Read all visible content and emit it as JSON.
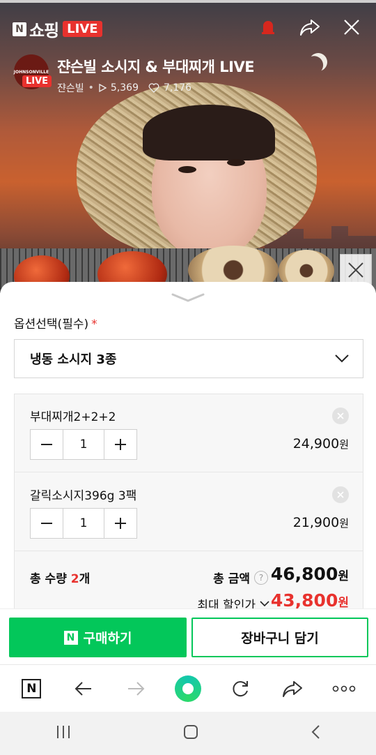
{
  "header": {
    "brand_mark": "N",
    "brand_name": "쇼핑",
    "live_tag": "LIVE"
  },
  "broadcast": {
    "title": "쟌슨빌 소시지 & 부대찌개 LIVE",
    "channel_name": "쟌슨빌",
    "separator": "•",
    "views": "5,369",
    "likes": "7,176",
    "avatar_brand": "JOHNSONVILLE",
    "avatar_live_badge": "LIVE"
  },
  "sheet": {
    "option_label": "옵션선택(필수)",
    "required_mark": "*",
    "selected_option": "냉동 소시지 3종",
    "items": [
      {
        "name": "부대찌개2+2+2",
        "quantity": "1",
        "price": "24,900",
        "currency": "원"
      },
      {
        "name": "갈릭소시지396g 3팩",
        "quantity": "1",
        "price": "21,900",
        "currency": "원"
      }
    ],
    "totals": {
      "quantity_label": "총 수량",
      "quantity_value": "2",
      "quantity_unit": "개",
      "amount_label": "총 금액",
      "help_glyph": "?",
      "amount_value": "46,800",
      "amount_unit": "원",
      "discount_label": "최대 할인가",
      "discount_value": "43,800",
      "discount_unit": "원"
    }
  },
  "actions": {
    "buy_logo": "N",
    "buy_label": "구매하기",
    "cart_label": "장바구니 담기"
  },
  "toolbar": {
    "home_logo": "N"
  },
  "colors": {
    "accent_green": "#03c75a",
    "live_red": "#e8322e",
    "price_red": "#e8322e"
  },
  "icons": [
    "bell-icon",
    "share-icon",
    "close-icon",
    "moon-icon",
    "chevron-down-icon",
    "minus-icon",
    "plus-icon",
    "remove-icon",
    "back-arrow-icon",
    "forward-arrow-icon",
    "refresh-icon",
    "more-icon",
    "recent-apps-icon",
    "home-icon"
  ]
}
